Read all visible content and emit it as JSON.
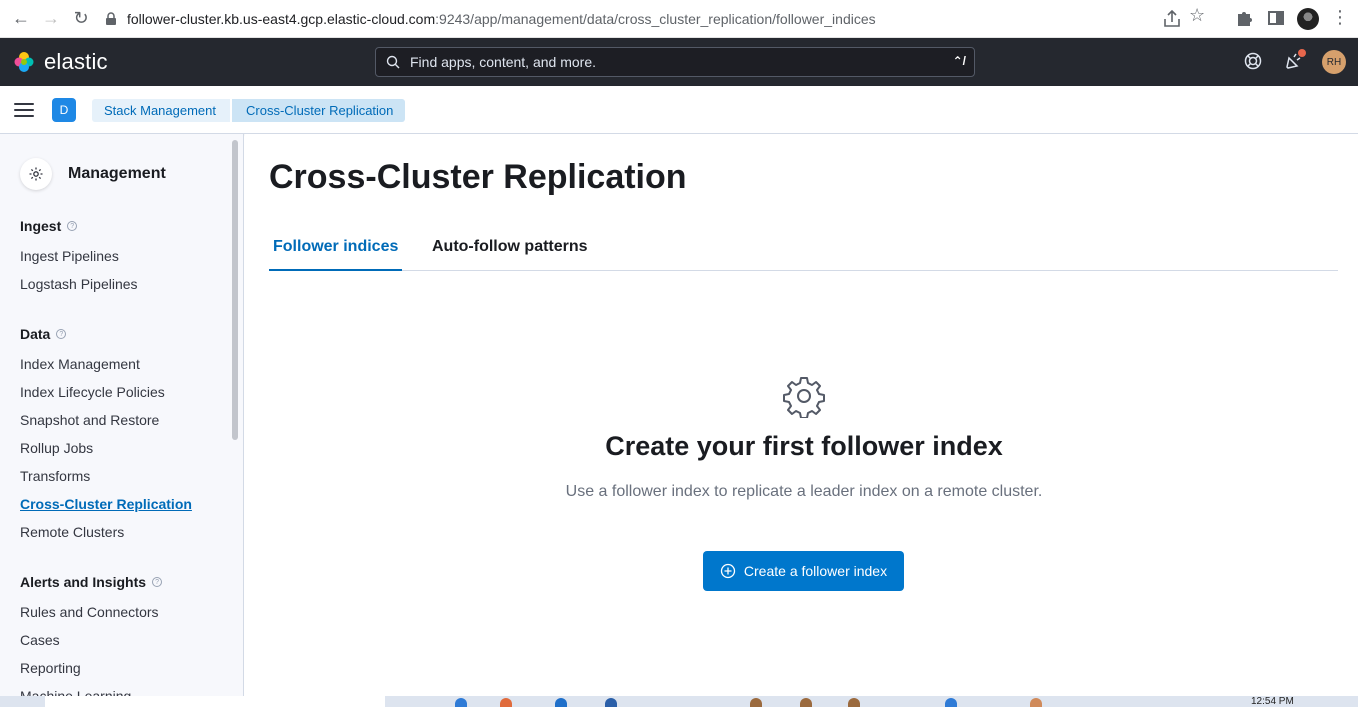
{
  "browser": {
    "url_host": "follower-cluster.kb.us-east4.gcp.elastic-cloud.com",
    "url_path": ":9243/app/management/data/cross_cluster_replication/follower_indices"
  },
  "header": {
    "logo_text": "elastic",
    "search_placeholder": "Find apps, content, and more.",
    "search_shortcut": "⌃/",
    "avatar_initials": "RH"
  },
  "subheader": {
    "space_initial": "D",
    "breadcrumbs": [
      "Stack Management",
      "Cross-Cluster Replication"
    ]
  },
  "sidebar": {
    "title": "Management",
    "sections": [
      {
        "title": "Ingest",
        "items": [
          "Ingest Pipelines",
          "Logstash Pipelines"
        ]
      },
      {
        "title": "Data",
        "items": [
          "Index Management",
          "Index Lifecycle Policies",
          "Snapshot and Restore",
          "Rollup Jobs",
          "Transforms",
          "Cross-Cluster Replication",
          "Remote Clusters"
        ]
      },
      {
        "title": "Alerts and Insights",
        "items": [
          "Rules and Connectors",
          "Cases",
          "Reporting",
          "Machine Learning"
        ]
      }
    ],
    "active_item": "Cross-Cluster Replication"
  },
  "main": {
    "title": "Cross-Cluster Replication",
    "tabs": [
      "Follower indices",
      "Auto-follow patterns"
    ],
    "empty_state": {
      "title": "Create your first follower index",
      "body": "Use a follower index to replicate a leader index on a remote cluster.",
      "button_label": "Create a follower index"
    }
  },
  "taskbar": {
    "time": "12:54 PM"
  },
  "colors": {
    "accent": "#0077cc",
    "header_bg": "#25282f",
    "link": "#006bb8"
  }
}
